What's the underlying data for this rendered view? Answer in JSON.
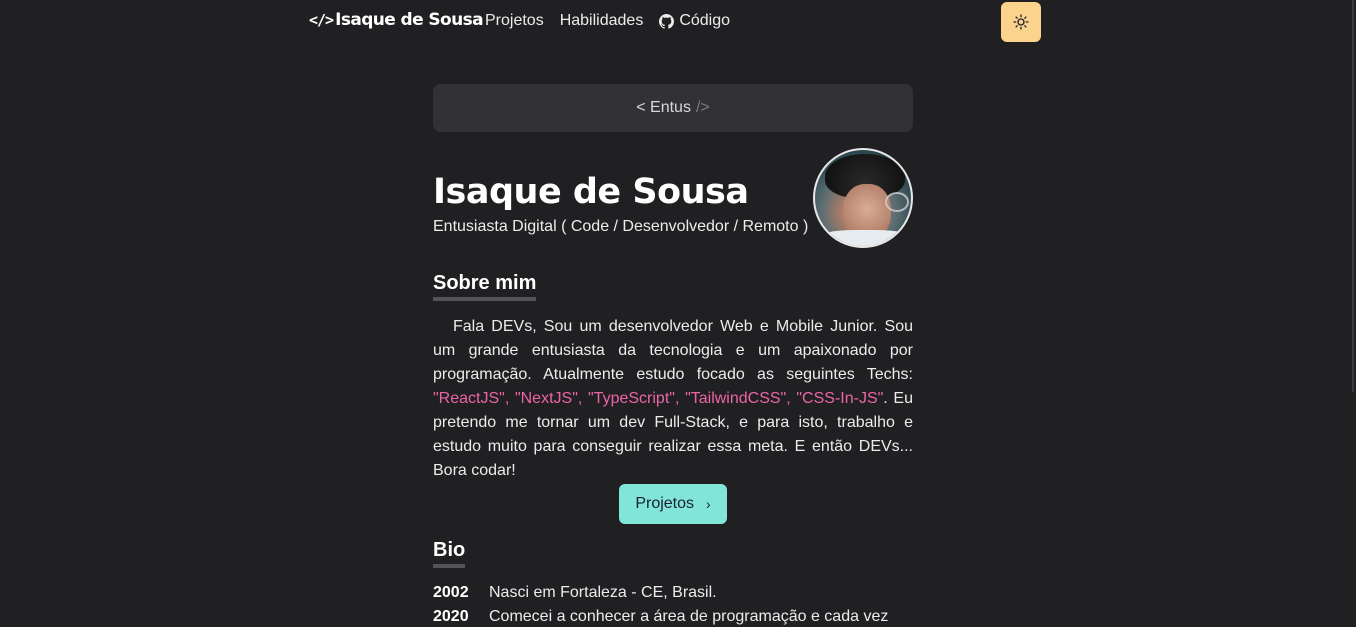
{
  "nav": {
    "brand_icon": "</>",
    "brand": "Isaque de Sousa",
    "links": [
      {
        "label": "Projetos"
      },
      {
        "label": "Habilidades"
      },
      {
        "label": "Código",
        "icon": "github-icon"
      }
    ],
    "theme_toggle": {
      "icon": "sun-icon",
      "color": "#fbd38d"
    }
  },
  "hello": {
    "open": "< Entus",
    "close": "/>"
  },
  "profile": {
    "name": "Isaque de Sousa",
    "role": "Entusiasta Digital ( Code / Desenvolvedor / Remoto )"
  },
  "about": {
    "heading": "Sobre mim",
    "text_before": "Fala DEVs, Sou um desenvolvedor Web e Mobile Junior. Sou um grande entusiasta da tecnologia e um apaixonado por programação. Atualmente estudo focado as seguintes Techs: ",
    "techs": "\"ReactJS\", \"NextJS\", \"TypeScript\", \"TailwindCSS\", \"CSS-In-JS\"",
    "text_after": ". Eu pretendo me tornar um dev Full-Stack, e para isto, trabalho e estudo muito para conseguir realizar essa meta. E então DEVs... Bora codar!",
    "button": "Projetos",
    "button_icon": "chevron-right-icon"
  },
  "bio": {
    "heading": "Bio",
    "items": [
      {
        "year": "2002",
        "text": "Nasci em Fortaleza - CE, Brasil."
      },
      {
        "year": "2020",
        "text": "Comecei a conhecer a área de programação e cada vez"
      }
    ]
  },
  "colors": {
    "background": "#202023",
    "accent_teal": "#81e6d9",
    "accent_pink": "#ed64a6",
    "toggle_yellow": "#fbd38d"
  }
}
